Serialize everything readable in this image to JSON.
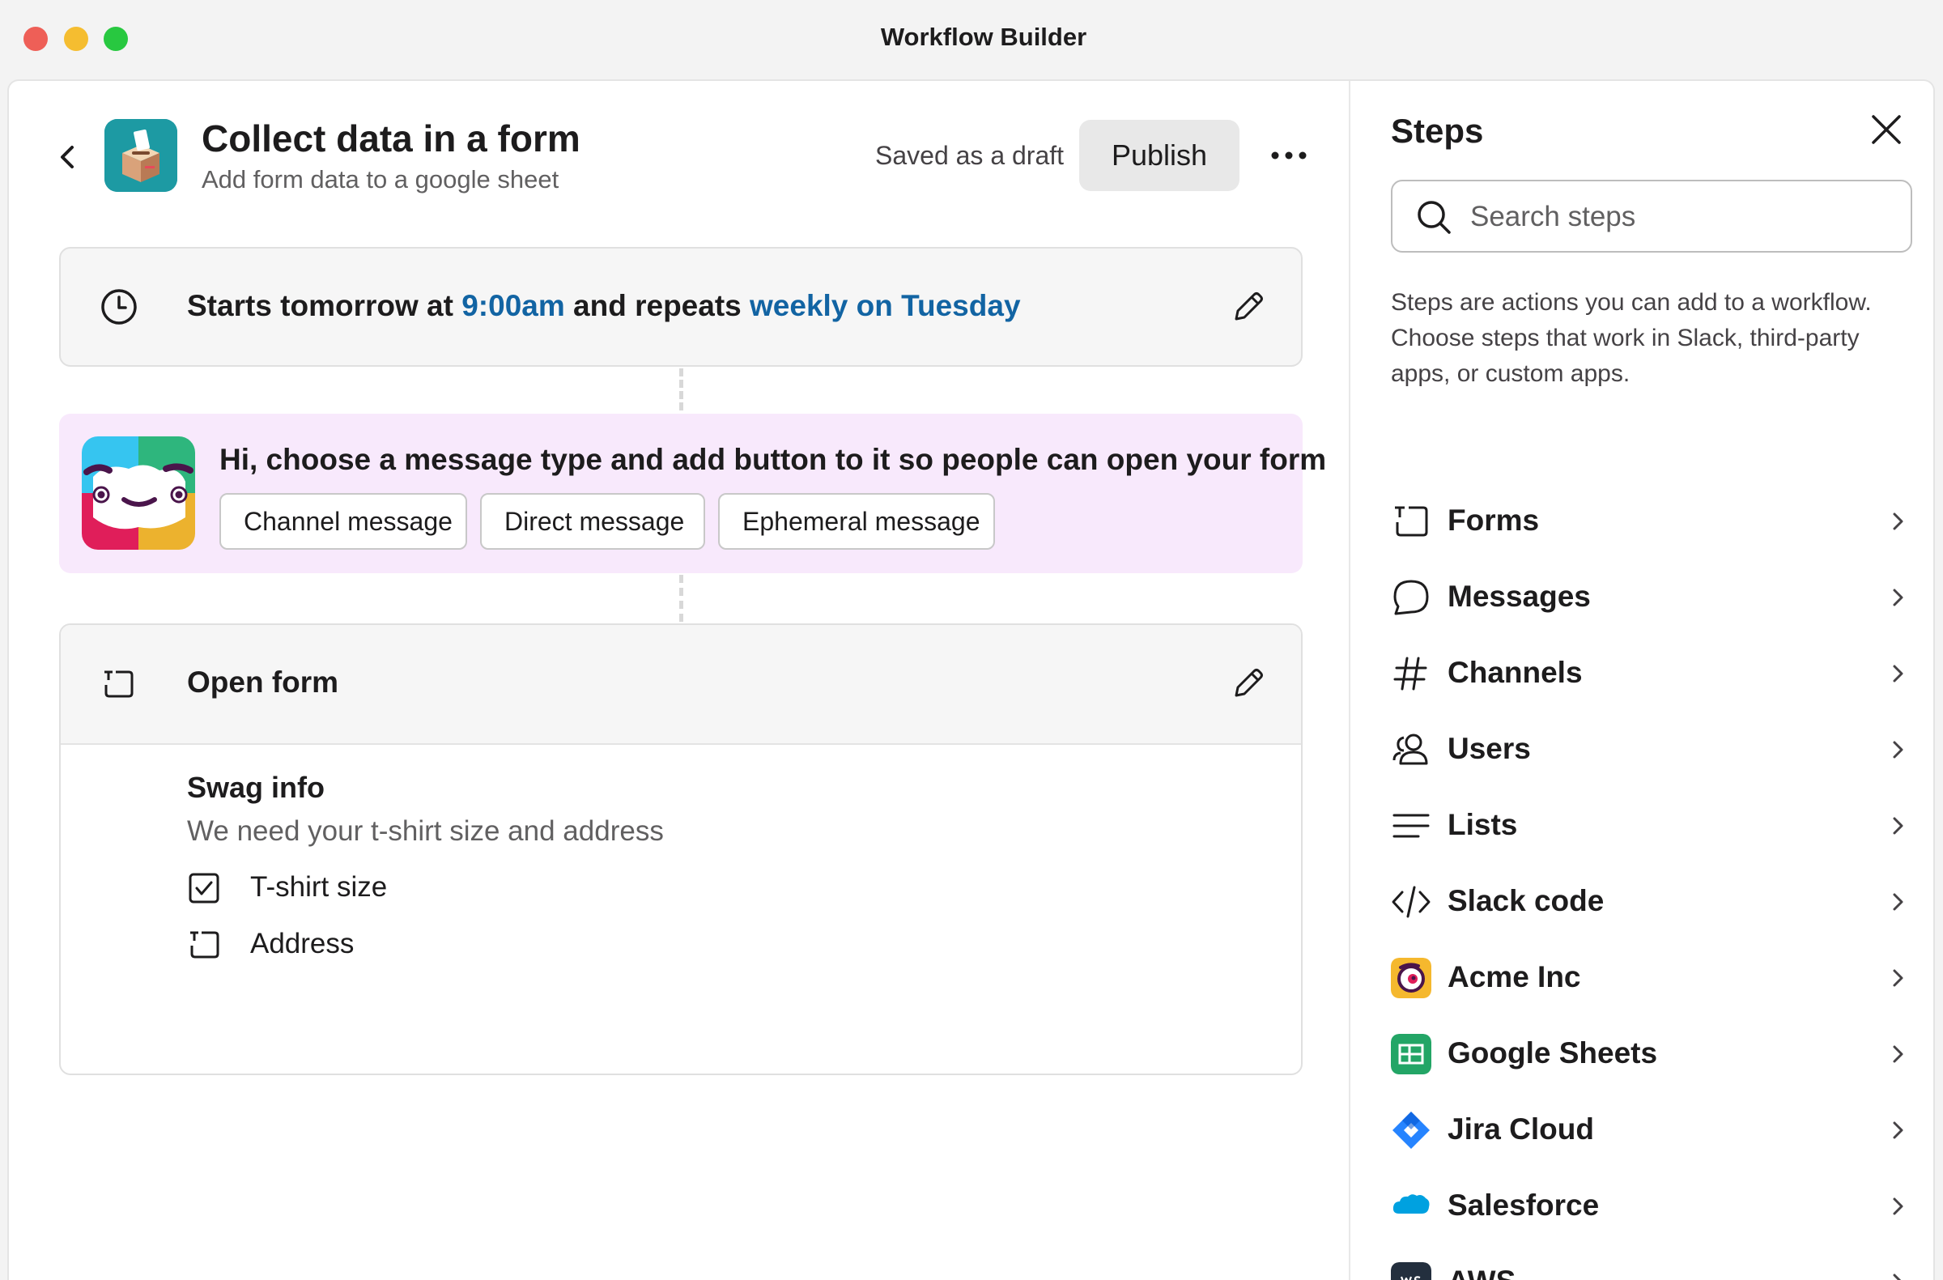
{
  "window": {
    "title": "Workflow Builder"
  },
  "header": {
    "title": "Collect data in a form",
    "subtitle": "Add form data to a google sheet",
    "status": "Saved as a draft",
    "publish_label": "Publish"
  },
  "schedule": {
    "prefix": "Starts tomorrow at ",
    "time": "9:00am",
    "middle": " and repeats ",
    "recurrence": "weekly on Tuesday"
  },
  "prompt": {
    "text": "Hi, choose a message type and add button to it so people can open your form",
    "options": [
      "Channel message",
      "Direct message",
      "Ephemeral message"
    ]
  },
  "form_step": {
    "title": "Open form",
    "form_name": "Swag info",
    "form_description": "We need your t-shirt size and address",
    "fields": [
      {
        "label": "T-shirt size",
        "icon": "checkbox-icon"
      },
      {
        "label": "Address",
        "icon": "text-field-icon"
      }
    ]
  },
  "steps_panel": {
    "title": "Steps",
    "search_placeholder": "Search steps",
    "description": "Steps are actions you can add to a workflow. Choose steps that work in Slack, third-party apps, or custom apps.",
    "categories": [
      {
        "label": "Forms",
        "icon": "form-icon"
      },
      {
        "label": "Messages",
        "icon": "message-bubble-icon"
      },
      {
        "label": "Channels",
        "icon": "hash-icon"
      },
      {
        "label": "Users",
        "icon": "users-icon"
      },
      {
        "label": "Lists",
        "icon": "list-icon"
      },
      {
        "label": "Slack code",
        "icon": "code-icon"
      },
      {
        "label": "Acme Inc",
        "icon": "acme-logo-icon"
      },
      {
        "label": "Google Sheets",
        "icon": "google-sheets-icon"
      },
      {
        "label": "Jira Cloud",
        "icon": "jira-icon"
      },
      {
        "label": "Salesforce",
        "icon": "salesforce-icon"
      },
      {
        "label": "AWS",
        "icon": "aws-icon"
      }
    ]
  },
  "colors": {
    "link": "#1264a3",
    "prompt_bg": "#f8e9fc",
    "publish_bg": "#e8e8e8"
  }
}
